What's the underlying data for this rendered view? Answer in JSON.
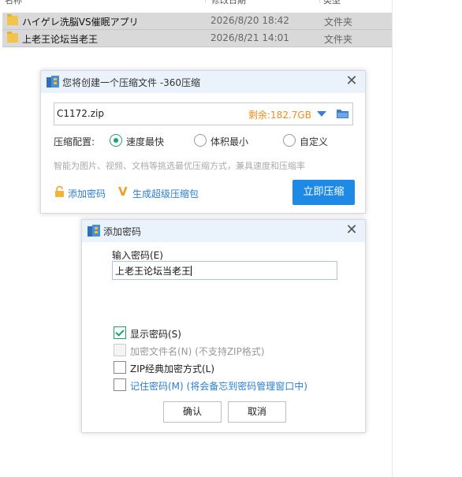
{
  "explorer": {
    "columns": [
      "名称",
      "修改日期",
      "类型"
    ],
    "rows": [
      {
        "name": "ハイゲレ洗脳VS催眠アプリ",
        "date": "2026/8/20 18:42",
        "type": "文件夹"
      },
      {
        "name": "上老王论坛当老王",
        "date": "2026/8/21 14:01",
        "type": "文件夹"
      }
    ]
  },
  "compress_dialog": {
    "title": "您将创建一个压缩文件 -360压缩",
    "filename": "C1172.zip",
    "remaining": "剩余:182.7GB",
    "config_label": "压缩配置:",
    "options": [
      "速度最快",
      "体积最小",
      "自定义"
    ],
    "selected_option": "速度最快",
    "hint": "智能为图片、视频、文档等挑选最优压缩方式，兼具速度和压缩率",
    "add_password_link": "添加密码",
    "super_package_link": "生成超级压缩包",
    "compress_button": "立即压缩"
  },
  "password_dialog": {
    "title": "添加密码",
    "input_label": "输入密码(E)",
    "input_value": "上老王论坛当老王",
    "checkboxes": [
      {
        "label": "显示密码(S)",
        "checked": true,
        "disabled": false
      },
      {
        "label": "加密文件名(N) (不支持ZIP格式)",
        "checked": false,
        "disabled": true
      },
      {
        "label": "ZIP经典加密方式(L)",
        "checked": false,
        "disabled": false
      },
      {
        "label": "记住密码(M) (将会备忘到密码管理窗口中)",
        "checked": false,
        "disabled": false
      }
    ],
    "ok_button": "确认",
    "cancel_button": "取消"
  },
  "colors": {
    "accent": "#1f8ae6",
    "link": "#2a7ed4",
    "remaining": "#f08c1e",
    "radio_check": "#1aa46c",
    "titlebar": "#eaf3fc"
  }
}
